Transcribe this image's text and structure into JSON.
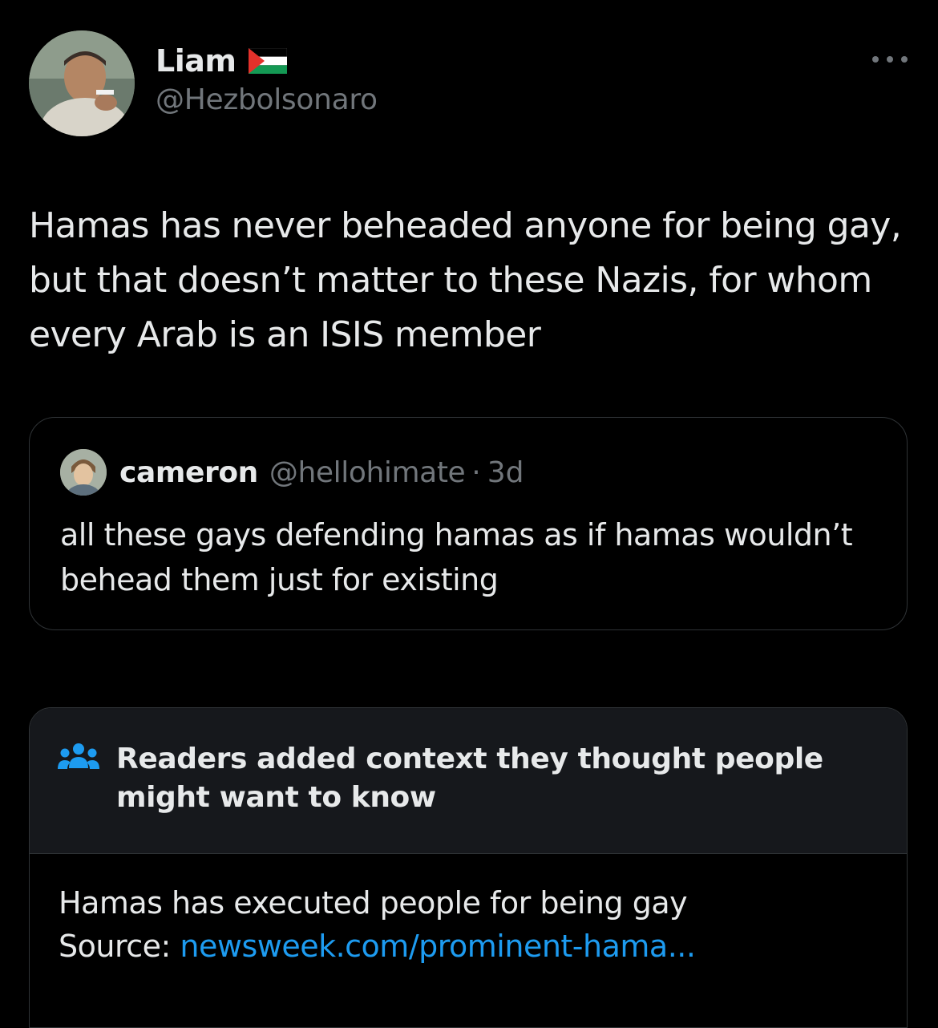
{
  "colors": {
    "background": "#000000",
    "text_primary": "#e7e9ea",
    "text_secondary": "#71767b",
    "border": "#2f3336",
    "note_header_bg": "#16181c",
    "link": "#1d9bf0"
  },
  "author": {
    "display_name": "Liam",
    "flag_icon": "palestine-flag-icon",
    "handle": "@Hezbolsonaro"
  },
  "tweet": {
    "text": "Hamas has never beheaded anyone for being gay, but that doesn’t matter to these Nazis, for whom every Arab is an ISIS member"
  },
  "quoted_tweet": {
    "display_name": "cameron",
    "handle": "@hellohimate",
    "separator": "·",
    "time": "3d",
    "text": "all these gays defending hamas as if hamas wouldn’t behead them just for existing"
  },
  "community_note": {
    "icon": "people-icon",
    "title": "Readers added context they thought people might want to know",
    "body_line1": "Hamas has executed people for being gay",
    "source_label": "Source: ",
    "source_link": "newsweek.com/prominent-hama..."
  },
  "more_icon": "more-horizontal-icon"
}
